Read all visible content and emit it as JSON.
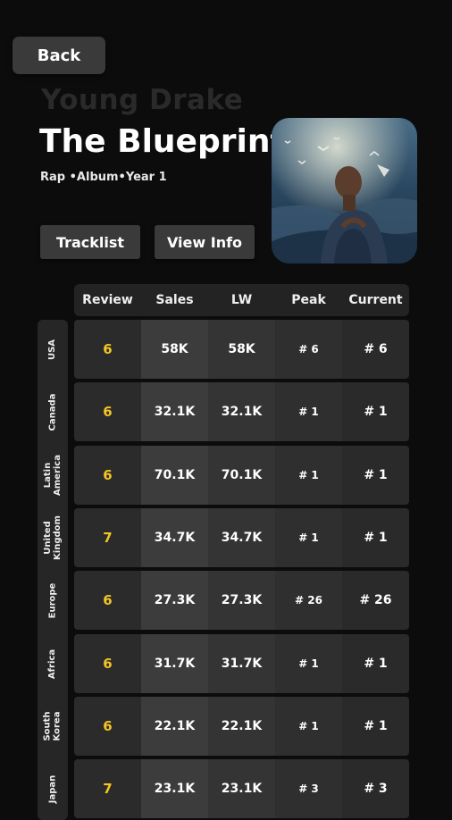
{
  "back_label": "Back",
  "artist": "Young Drake",
  "album_title": "The Blueprint",
  "meta": "Rap •Album•Year 1",
  "buttons": {
    "tracklist": "Tracklist",
    "view_info": "View Info"
  },
  "table": {
    "columns": [
      "Review",
      "Sales",
      "LW",
      "Peak",
      "Current"
    ],
    "rows": [
      {
        "region": "USA",
        "review": "6",
        "sales": "58K",
        "lw": "58K",
        "peak": "# 6",
        "current": "# 6"
      },
      {
        "region": "Canada",
        "review": "6",
        "sales": "32.1K",
        "lw": "32.1K",
        "peak": "# 1",
        "current": "# 1"
      },
      {
        "region": "Latin\nAmerica",
        "review": "6",
        "sales": "70.1K",
        "lw": "70.1K",
        "peak": "# 1",
        "current": "# 1"
      },
      {
        "region": "United\nKingdom",
        "review": "7",
        "sales": "34.7K",
        "lw": "34.7K",
        "peak": "# 1",
        "current": "# 1"
      },
      {
        "region": "Europe",
        "review": "6",
        "sales": "27.3K",
        "lw": "27.3K",
        "peak": "# 26",
        "current": "# 26"
      },
      {
        "region": "Africa",
        "review": "6",
        "sales": "31.7K",
        "lw": "31.7K",
        "peak": "# 1",
        "current": "# 1"
      },
      {
        "region": "South\nKorea",
        "review": "6",
        "sales": "22.1K",
        "lw": "22.1K",
        "peak": "# 1",
        "current": "# 1"
      },
      {
        "region": "Japan",
        "review": "7",
        "sales": "23.1K",
        "lw": "23.1K",
        "peak": "# 3",
        "current": "# 3"
      }
    ]
  },
  "colors": {
    "accent_review": "#f3c623",
    "background": "#0c0c0c"
  }
}
